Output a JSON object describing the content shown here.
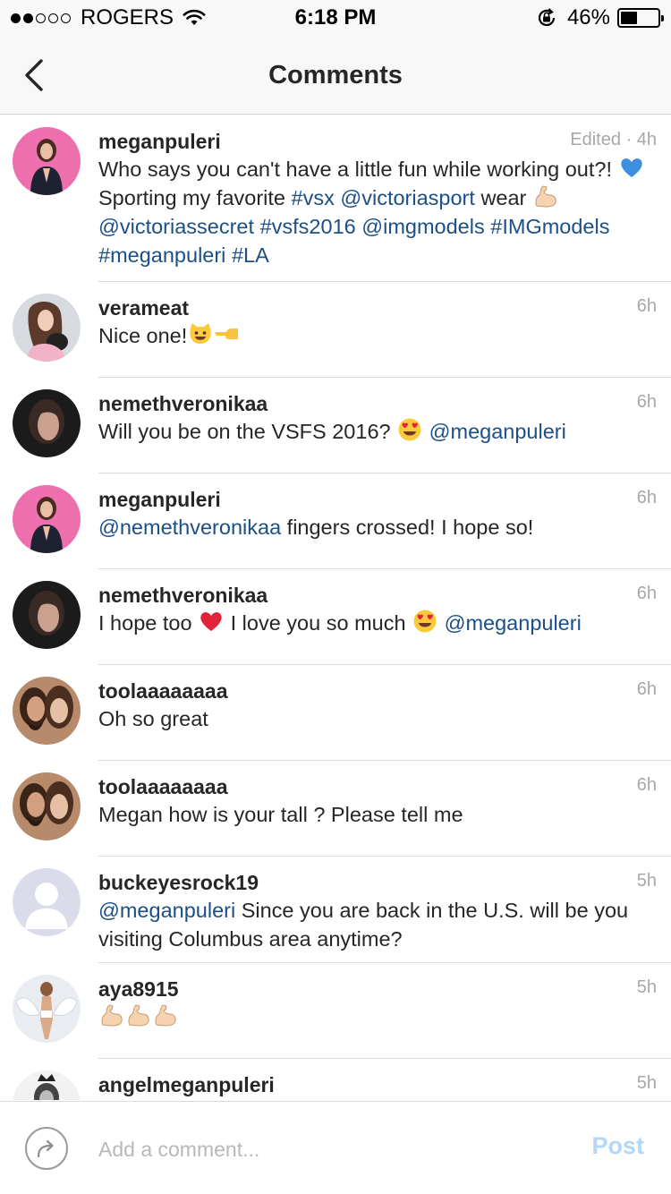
{
  "status_bar": {
    "carrier": "ROGERS",
    "time": "6:18 PM",
    "battery": "46%",
    "battery_level": 0.46
  },
  "nav": {
    "title": "Comments"
  },
  "comments": [
    {
      "user": "meganpuleri",
      "time": "Edited · 4h",
      "text": [
        {
          "t": "Who says you can't have a little fun while working out?! "
        },
        {
          "e": "blue-heart"
        },
        {
          "t": " Sporting my favorite "
        },
        {
          "l": "#vsx"
        },
        {
          "t": " "
        },
        {
          "l": "@victoriasport"
        },
        {
          "t": " wear "
        },
        {
          "e": "flexed-biceps"
        },
        {
          "t": " "
        },
        {
          "l": "@victoriassecret"
        },
        {
          "t": " "
        },
        {
          "l": "#vsfs2016"
        },
        {
          "t": " "
        },
        {
          "l": "@imgmodels"
        },
        {
          "t": " "
        },
        {
          "l": "#IMGmodels"
        },
        {
          "t": " "
        },
        {
          "l": "#meganpuleri"
        },
        {
          "t": " "
        },
        {
          "l": "#LA"
        }
      ],
      "avatar": "pink"
    },
    {
      "user": "verameat",
      "time": "6h",
      "text": [
        {
          "t": "Nice one!"
        },
        {
          "e": "grinning-cat"
        },
        {
          "e": "pointing-left"
        }
      ],
      "avatar": "light"
    },
    {
      "user": "nemethveronikaa",
      "time": "6h",
      "text": [
        {
          "t": "Will you be on the VSFS 2016? "
        },
        {
          "e": "heart-eyes"
        },
        {
          "t": " "
        },
        {
          "l": "@meganpuleri"
        }
      ],
      "avatar": "dark"
    },
    {
      "user": "meganpuleri",
      "time": "6h",
      "text": [
        {
          "l": "@nemethveronikaa"
        },
        {
          "t": " fingers crossed! I hope so!"
        }
      ],
      "avatar": "pink"
    },
    {
      "user": "nemethveronikaa",
      "time": "6h",
      "text": [
        {
          "t": "I hope too "
        },
        {
          "e": "red-heart"
        },
        {
          "t": " I love you so much "
        },
        {
          "e": "heart-eyes"
        },
        {
          "t": " "
        },
        {
          "l": "@meganpuleri"
        }
      ],
      "avatar": "dark"
    },
    {
      "user": "toolaaaaaaaa",
      "time": "6h",
      "text": [
        {
          "t": "Oh so great"
        }
      ],
      "avatar": "couple"
    },
    {
      "user": "toolaaaaaaaa",
      "time": "6h",
      "text": [
        {
          "t": "Megan how is your tall ?  Please tell me"
        }
      ],
      "avatar": "couple"
    },
    {
      "user": "buckeyesrock19",
      "time": "5h",
      "text": [
        {
          "l": "@meganpuleri"
        },
        {
          "t": " Since you are back in the U.S. will be you visiting Columbus area anytime?"
        }
      ],
      "avatar": "default"
    },
    {
      "user": "aya8915",
      "time": "5h",
      "text": [
        {
          "e": "flexed-biceps"
        },
        {
          "e": "flexed-biceps"
        },
        {
          "e": "flexed-biceps"
        }
      ],
      "avatar": "angel"
    },
    {
      "user": "angelmeganpuleri",
      "time": "5h",
      "text": [],
      "avatar": "bw"
    }
  ],
  "composer": {
    "placeholder": "Add a comment...",
    "post_label": "Post"
  },
  "colors": {
    "link": "#1c4f86",
    "time": "#a8a8a8",
    "post_disabled": "#b3d7f8"
  }
}
